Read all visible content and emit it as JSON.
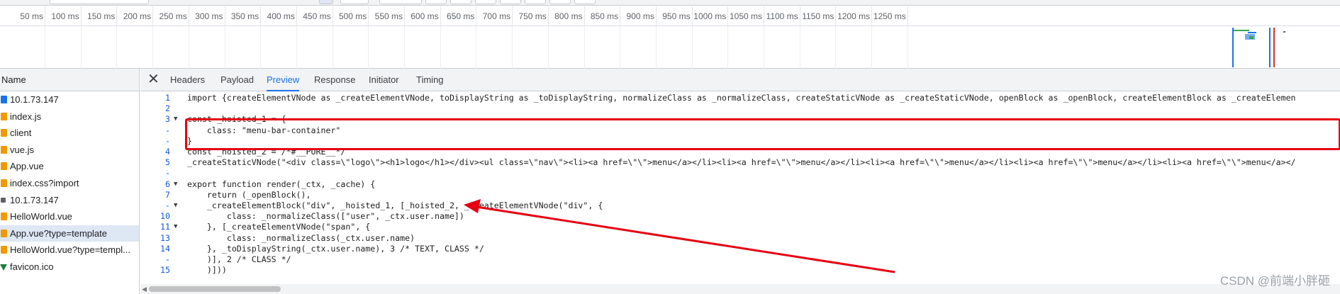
{
  "timeline": {
    "ticks": [
      "50 ms",
      "100 ms",
      "150 ms",
      "200 ms",
      "250 ms",
      "300 ms",
      "350 ms",
      "400 ms",
      "450 ms",
      "500 ms",
      "550 ms",
      "600 ms",
      "650 ms",
      "700 ms",
      "750 ms",
      "800 ms",
      "850 ms",
      "900 ms",
      "950 ms",
      "1000 ms",
      "1050 ms",
      "1100 ms",
      "1150 ms",
      "1200 ms",
      "1250 ms"
    ]
  },
  "request_list": {
    "header": "Name",
    "items": [
      {
        "name": "10.1.73.147",
        "icon": "document-icon",
        "kind": "doc"
      },
      {
        "name": "index.js",
        "icon": "script-icon",
        "kind": "script"
      },
      {
        "name": "client",
        "icon": "script-icon",
        "kind": "script"
      },
      {
        "name": "vue.js",
        "icon": "script-icon",
        "kind": "script"
      },
      {
        "name": "App.vue",
        "icon": "script-icon",
        "kind": "script"
      },
      {
        "name": "index.css?import",
        "icon": "script-icon",
        "kind": "script"
      },
      {
        "name": "10.1.73.147",
        "icon": "other-icon",
        "kind": "other"
      },
      {
        "name": "HelloWorld.vue",
        "icon": "script-icon",
        "kind": "script"
      },
      {
        "name": "App.vue?type=template",
        "icon": "script-icon",
        "kind": "script",
        "selected": true
      },
      {
        "name": "HelloWorld.vue?type=templ...",
        "icon": "script-icon",
        "kind": "script"
      },
      {
        "name": "favicon.ico",
        "icon": "favicon-icon",
        "kind": "fav"
      }
    ]
  },
  "detail_tabs": {
    "close": "✕",
    "tabs": [
      "Headers",
      "Payload",
      "Preview",
      "Response",
      "Initiator",
      "Timing"
    ],
    "active": "Preview"
  },
  "code": {
    "lines": [
      {
        "ln": "1",
        "fold": "",
        "text": "import {createElementVNode as _createElementVNode, toDisplayString as _toDisplayString, normalizeClass as _normalizeClass, createStaticVNode as _createStaticVNode, openBlock as _openBlock, createElementBlock as _createElemen"
      },
      {
        "ln": "2",
        "fold": "",
        "text": ""
      },
      {
        "ln": "3",
        "fold": "▼",
        "text": "const _hoisted_1 = {"
      },
      {
        "ln": "-",
        "fold": "",
        "text": "    class: \"menu-bar-container\""
      },
      {
        "ln": "-",
        "fold": "",
        "text": "}"
      },
      {
        "ln": "4",
        "fold": "",
        "text": "const _hoisted_2 = /*#__PURE__*/"
      },
      {
        "ln": "5",
        "fold": "",
        "text": "_createStaticVNode(\"<div class=\\\"logo\\\"><h1>logo</h1></div><ul class=\\\"nav\\\"><li><a href=\\\"\\\">menu</a></li><li><a href=\\\"\\\">menu</a></li><li><a href=\\\"\\\">menu</a></li><li><a href=\\\"\\\">menu</a></li><li><a href=\\\"\\\">menu</a></"
      },
      {
        "ln": "-",
        "fold": "",
        "text": ""
      },
      {
        "ln": "6",
        "fold": "▼",
        "text": "export function render(_ctx, _cache) {"
      },
      {
        "ln": "7",
        "fold": "",
        "text": "    return (_openBlock(),"
      },
      {
        "ln": "-",
        "fold": "▼",
        "text": "    _createElementBlock(\"div\", _hoisted_1, [_hoisted_2, _createElementVNode(\"div\", {"
      },
      {
        "ln": "10",
        "fold": "",
        "text": "        class: _normalizeClass([\"user\", _ctx.user.name])"
      },
      {
        "ln": "11",
        "fold": "▼",
        "text": "    }, [_createElementVNode(\"span\", {"
      },
      {
        "ln": "13",
        "fold": "",
        "text": "        class: _normalizeClass(_ctx.user.name)"
      },
      {
        "ln": "14",
        "fold": "",
        "text": "    }, _toDisplayString(_ctx.user.name), 3 /* TEXT, CLASS */"
      },
      {
        "ln": "-",
        "fold": "",
        "text": "    )], 2 /* CLASS */"
      },
      {
        "ln": "15",
        "fold": "",
        "text": "    )]))"
      }
    ]
  },
  "watermark": "CSDN @前端小胖砸",
  "colors": {
    "accent": "#1a73e8",
    "annotation_red": "#e60012"
  }
}
